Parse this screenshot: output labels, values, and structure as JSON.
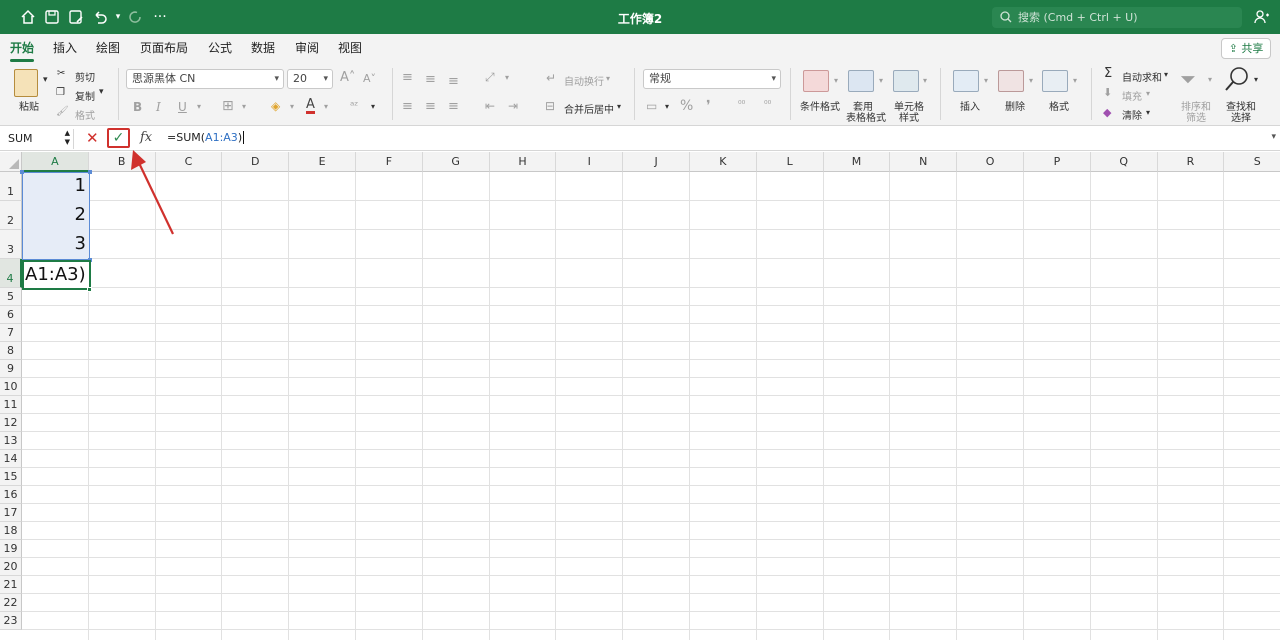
{
  "window": {
    "title": "工作簿2",
    "search_placeholder": "搜索 (Cmd + Ctrl + U)"
  },
  "titlebar_icons": [
    "home-icon",
    "save-icon",
    "save-as-icon",
    "undo-icon",
    "undo-dropdown-icon",
    "redo-icon",
    "more-icon"
  ],
  "tabs": [
    "开始",
    "插入",
    "绘图",
    "页面布局",
    "公式",
    "数据",
    "审阅",
    "视图"
  ],
  "active_tab": "开始",
  "share_label": "共享",
  "ribbon": {
    "paste": "粘贴",
    "cut": "剪切",
    "copy": "复制",
    "format_painter": "格式",
    "font_name": "思源黑体 CN",
    "font_size": "20",
    "bold": "B",
    "italic": "I",
    "underline": "U",
    "wrap_text": "自动换行",
    "merge_center": "合并后居中",
    "number_format": "常规",
    "conditional_format": "条件格式",
    "table_format_1": "套用",
    "table_format_2": "表格格式",
    "cell_style_1": "单元格",
    "cell_style_2": "样式",
    "insert": "插入",
    "delete": "删除",
    "format": "格式",
    "autosum": "自动求和",
    "fill": "填充",
    "clear": "清除",
    "sort_1": "排序和",
    "sort_2": "筛选",
    "find_1": "查找和",
    "find_2": "选择"
  },
  "formula_bar": {
    "name_box": "SUM",
    "fx": "fx",
    "formula_prefix": "=SUM(",
    "formula_ref": "A1:A3",
    "formula_suffix": ")"
  },
  "columns": [
    "A",
    "B",
    "C",
    "D",
    "E",
    "F",
    "G",
    "H",
    "I",
    "J",
    "K",
    "L",
    "M",
    "N",
    "O",
    "P",
    "Q",
    "R",
    "S"
  ],
  "rows": [
    "1",
    "2",
    "3",
    "4",
    "5",
    "6",
    "7",
    "8",
    "9",
    "10",
    "11",
    "12",
    "13",
    "14",
    "15",
    "16",
    "17",
    "18",
    "19",
    "20",
    "21",
    "22",
    "23"
  ],
  "cells": {
    "A1": "1",
    "A2": "2",
    "A3": "3",
    "A4": "A1:A3)"
  },
  "selected_column": "A",
  "selected_row": "4",
  "colors": {
    "brand": "#1e7b45",
    "range_border": "#5b8bd6",
    "annotation": "#d0312d"
  }
}
